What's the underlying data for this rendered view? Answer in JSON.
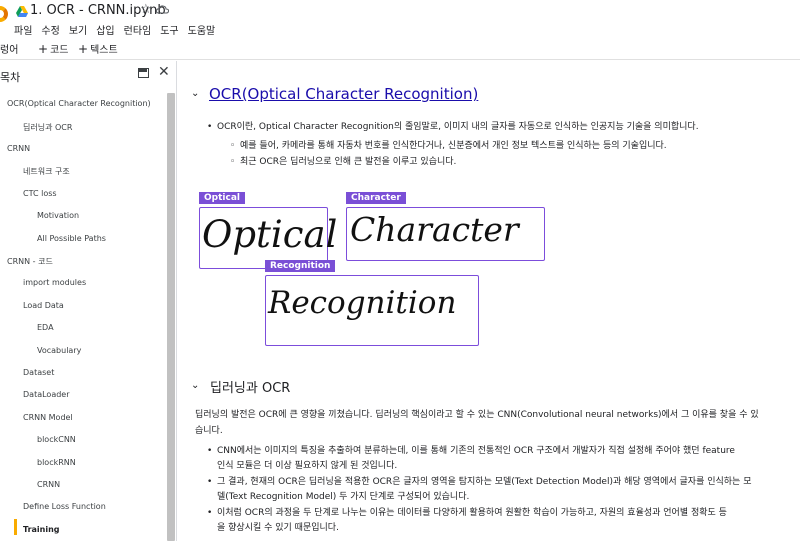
{
  "header": {
    "title": "1. OCR - CRNN.ipynb",
    "menu": [
      "파일",
      "수정",
      "보기",
      "삽입",
      "런타임",
      "도구",
      "도움말"
    ]
  },
  "toolbar": {
    "truncated_label": "렁어",
    "add_code": "코드",
    "add_text": "텍스트"
  },
  "sidebar": {
    "title": "목차",
    "items": [
      {
        "label": "OCR(Optical Character Recognition)"
      },
      {
        "label": "딥러닝과 OCR"
      },
      {
        "label": "CRNN"
      },
      {
        "label": "네트워크 구조"
      },
      {
        "label": "CTC loss"
      },
      {
        "label": "Motivation"
      },
      {
        "label": "All Possible Paths"
      },
      {
        "label": "CRNN - 코드"
      },
      {
        "label": "import modules"
      },
      {
        "label": "Load Data"
      },
      {
        "label": "EDA"
      },
      {
        "label": "Vocabulary"
      },
      {
        "label": "Dataset"
      },
      {
        "label": "DataLoader"
      },
      {
        "label": "CRNN Model"
      },
      {
        "label": "blockCNN"
      },
      {
        "label": "blockRNN"
      },
      {
        "label": "CRNN"
      },
      {
        "label": "Define Loss Function"
      },
      {
        "label": "Training"
      }
    ]
  },
  "content": {
    "heading1": "OCR(Optical Character Recognition)",
    "bullets1": [
      "OCR이란, Optical Character Recognition의 줄임말로, 이미지 내의 글자를 자동으로 인식하는 인공지능 기술을 의미합니다.",
      "예를 들어, 카메라를 통해 자동차 번호를 인식한다거나, 신분증에서 개인 정보 텍스트를 인식하는 등의 기술입니다.",
      "최근 OCR은 딥러닝으로 인해 큰 발전을 이루고 있습니다."
    ],
    "illustration": {
      "tags": [
        "Optical",
        "Character",
        "Recognition"
      ],
      "words": [
        "Optical",
        "Character",
        "Recognition"
      ]
    },
    "heading2": "딥러닝과 OCR",
    "para_line1": "딥러닝의 발전은 OCR에 큰 영향을 끼쳤습니다. 딥러닝의 핵심이라고 할 수 있는 CNN(Convolutional neural networks)에서 그 이유를 찾을 수 있",
    "para_line2": "습니다.",
    "bullets2": [
      {
        "l1": "CNN에서는 이미지의 특징을 추출하여 분류하는데, 이를 통해 기존의 전통적인 OCR 구조에서 개발자가 직접 설정해 주어야 했던 feature",
        "l2": "인식 모듈은 더 이상 필요하지 않게 된 것입니다."
      },
      {
        "l1": "그 결과, 현재의 OCR은 딥러닝을 적용한 OCR은 글자의 영역을 탐지하는 모델(Text Detection Model)과 해당 영역에서 글자를 인식하는 모",
        "l2": "델(Text Recognition Model) 두 가지 단계로 구성되어 있습니다."
      },
      {
        "l1": "이처럼 OCR의 과정을 두 단계로 나누는 이유는 데이터를 다양하게 활용하여 원활한 학습이 가능하고, 자원의 효율성과 언어별 정확도 등",
        "l2": "을 향상시킬 수 있기 때문입니다."
      }
    ]
  },
  "colors": {
    "link": "#1a0dab",
    "accent_purple": "#7a4fd6",
    "active_marker": "#f9ab00"
  }
}
